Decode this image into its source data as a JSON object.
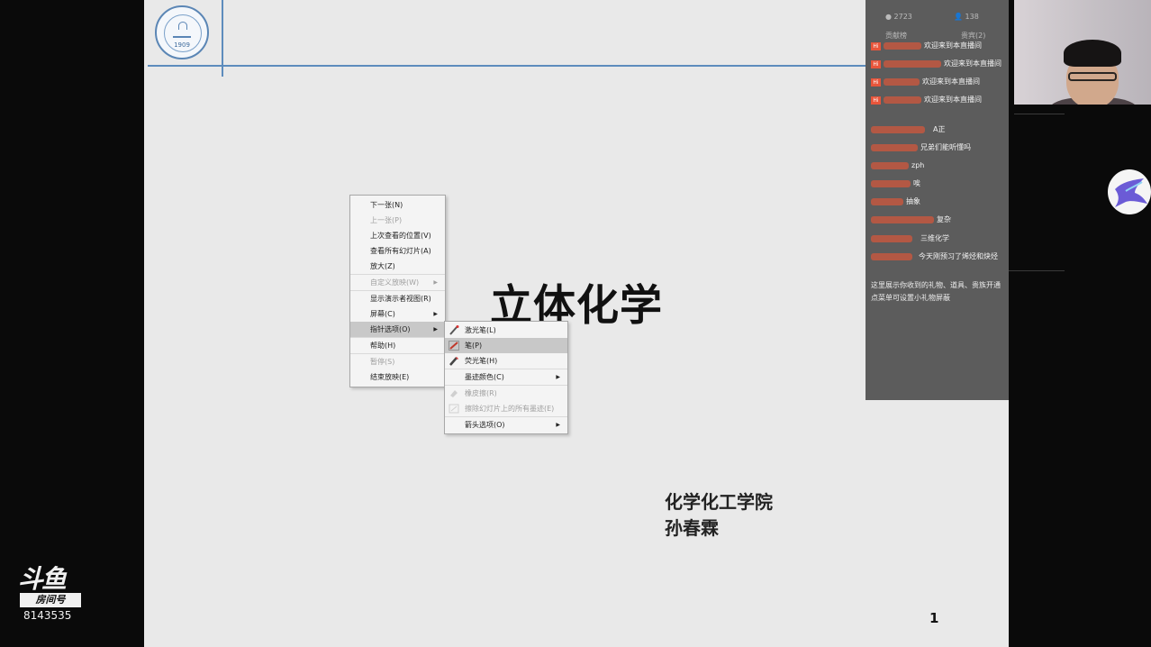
{
  "slide": {
    "title": "立体化学",
    "department": "化学化工学院",
    "author": "孙春霖",
    "page_number": "1",
    "logo_year": "1909"
  },
  "context_menu": {
    "items": [
      {
        "label": "下一张(N)",
        "disabled": false
      },
      {
        "label": "上一张(P)",
        "disabled": true
      },
      {
        "label": "上次查看的位置(V)",
        "disabled": false
      },
      {
        "label": "查看所有幻灯片(A)",
        "disabled": false
      },
      {
        "label": "放大(Z)",
        "disabled": false
      },
      {
        "label": "自定义放映(W)",
        "disabled": true
      },
      {
        "label": "显示演示者视图(R)",
        "disabled": false
      },
      {
        "label": "屏幕(C)",
        "disabled": false
      },
      {
        "label": "指针选项(O)",
        "disabled": false
      },
      {
        "label": "帮助(H)",
        "disabled": false
      },
      {
        "label": "暂停(S)",
        "disabled": true
      },
      {
        "label": "结束放映(E)",
        "disabled": false
      }
    ]
  },
  "pointer_submenu": {
    "items": [
      {
        "label": "激光笔(L)",
        "icon": "laser-pen-icon",
        "disabled": false
      },
      {
        "label": "笔(P)",
        "icon": "pen-icon",
        "disabled": false
      },
      {
        "label": "荧光笔(H)",
        "icon": "highlighter-icon",
        "disabled": false
      },
      {
        "label": "墨迹颜色(C)",
        "icon": "",
        "disabled": false
      },
      {
        "label": "橡皮擦(R)",
        "icon": "eraser-icon",
        "disabled": true
      },
      {
        "label": "擦除幻灯片上的所有墨迹(E)",
        "icon": "erase-all-icon",
        "disabled": true
      },
      {
        "label": "箭头选项(O)",
        "icon": "",
        "disabled": false
      }
    ]
  },
  "chat": {
    "stats": {
      "viewers": "2723",
      "fans": "138",
      "left_label": "贡献榜",
      "right_label": "贵宾(2)"
    },
    "welcome": [
      {
        "badge": "Hi",
        "msg": "欢迎来到本直播间"
      },
      {
        "badge": "Hi",
        "msg": "欢迎来到本直播间"
      },
      {
        "badge": "Hi",
        "msg": "欢迎来到本直播间"
      },
      {
        "badge": "Hi",
        "msg": "欢迎来到本直播间"
      }
    ],
    "messages": [
      {
        "msg": "A正"
      },
      {
        "msg": "兄弟们能听懂吗"
      },
      {
        "msg": "zph"
      },
      {
        "msg": "唉"
      },
      {
        "msg": "抽象"
      },
      {
        "msg": "复杂"
      },
      {
        "msg": "三维化学"
      },
      {
        "msg": "今天刚预习了烯烃和炔烃"
      }
    ],
    "notice_line1": "这里展示你收到的礼物、道具、贵族开通",
    "notice_line2": "点菜单可设置小礼物屏蔽"
  },
  "douyu": {
    "brand": "斗鱼",
    "room_label": "房间号",
    "room_number": "8143535"
  }
}
